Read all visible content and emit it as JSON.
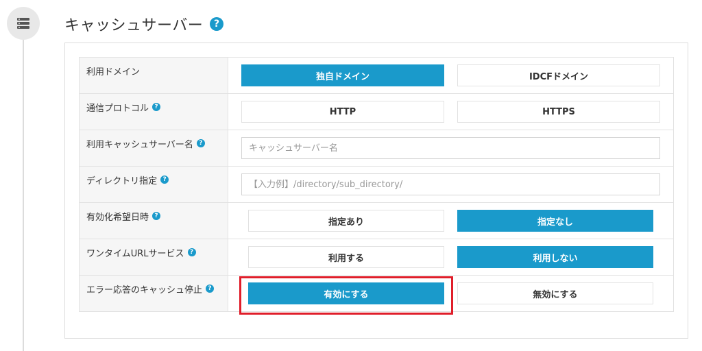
{
  "section": {
    "title": "キャッシュサーバー",
    "help_icon": "question-circle-icon",
    "node_icon": "server-icon"
  },
  "rows": [
    {
      "label": "利用ドメイン",
      "help": false,
      "options": [
        {
          "label": "独自ドメイン",
          "selected": true
        },
        {
          "label": "IDCFドメイン",
          "selected": false
        }
      ]
    },
    {
      "label": "通信プロトコル",
      "help": true,
      "options": [
        {
          "label": "HTTP",
          "selected": false
        },
        {
          "label": "HTTPS",
          "selected": false
        }
      ]
    },
    {
      "label": "利用キャッシュサーバー名",
      "help": true,
      "input": {
        "value": "",
        "placeholder": "キャッシュサーバー名"
      }
    },
    {
      "label": "ディレクトリ指定",
      "help": true,
      "input": {
        "value": "",
        "placeholder": "【入力例】/directory/sub_directory/"
      }
    },
    {
      "label": "有効化希望日時",
      "help": true,
      "options": [
        {
          "label": "指定あり",
          "selected": false
        },
        {
          "label": "指定なし",
          "selected": true
        }
      ]
    },
    {
      "label": "ワンタイムURLサービス",
      "help": true,
      "options": [
        {
          "label": "利用する",
          "selected": false
        },
        {
          "label": "利用しない",
          "selected": true
        }
      ]
    },
    {
      "label": "エラー応答のキャッシュ停止",
      "help": true,
      "options": [
        {
          "label": "有効にする",
          "selected": true
        },
        {
          "label": "無効にする",
          "selected": false
        }
      ]
    }
  ],
  "colors": {
    "accent": "#1a9acb",
    "highlight": "#e01e2a"
  }
}
